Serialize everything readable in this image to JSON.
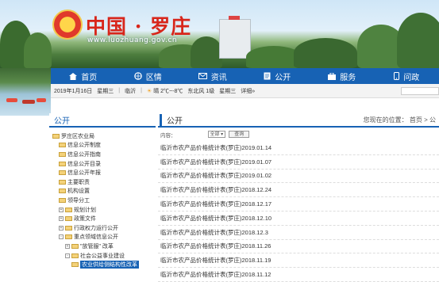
{
  "banner": {
    "brand": "中国 · 罗庄",
    "url": "www.luozhuang.gov.cn"
  },
  "nav": [
    {
      "label": "首页",
      "icon": "home-icon"
    },
    {
      "label": "区情",
      "icon": "globe-icon"
    },
    {
      "label": "资讯",
      "icon": "mail-icon"
    },
    {
      "label": "公开",
      "icon": "document-icon"
    },
    {
      "label": "服务",
      "icon": "service-icon"
    },
    {
      "label": "问政",
      "icon": "phone-icon"
    }
  ],
  "info": {
    "date": "2019年1月16日",
    "weekday": "星期三",
    "city": "临沂",
    "weather": "晴 2℃~-8℃",
    "wind": "东北风 1级",
    "day": "星期三",
    "detail": "详细»"
  },
  "sidebar": {
    "title": "公开",
    "items": [
      {
        "label": "罗庄区农业局",
        "level": 0,
        "toggle": ""
      },
      {
        "label": "信息公开制度",
        "level": 1,
        "toggle": ""
      },
      {
        "label": "信息公开指南",
        "level": 1,
        "toggle": ""
      },
      {
        "label": "信息公开目录",
        "level": 1,
        "toggle": ""
      },
      {
        "label": "信息公开年报",
        "level": 1,
        "toggle": ""
      },
      {
        "label": "主要职责",
        "level": 1,
        "toggle": ""
      },
      {
        "label": "机构设置",
        "level": 1,
        "toggle": ""
      },
      {
        "label": "领导分工",
        "level": 1,
        "toggle": ""
      },
      {
        "label": "规划计划",
        "level": 1,
        "toggle": "+"
      },
      {
        "label": "政策文件",
        "level": 1,
        "toggle": "+"
      },
      {
        "label": "行政权力运行公开",
        "level": 1,
        "toggle": "+"
      },
      {
        "label": "重点领域信息公开",
        "level": 1,
        "toggle": "-"
      },
      {
        "label": "\"放管服\" 改革",
        "level": 2,
        "toggle": "+"
      },
      {
        "label": "社会公益事业建设",
        "level": 2,
        "toggle": "-"
      },
      {
        "label": "农业供给侧结构性改革",
        "level": 3,
        "toggle": "",
        "active": true
      }
    ]
  },
  "main": {
    "title": "公开",
    "breadcrumb": "您现在的位置： 首页 > 公",
    "filter_label": "内容：",
    "filter_value": "全部",
    "search_button": "查询",
    "rows": [
      "临沂市农产品价格统计表(罗庄)2019.01.14",
      "临沂市农产品价格统计表(罗庄)2019.01.07",
      "临沂市农产品价格统计表(罗庄)2019.01.02",
      "临沂市农产品价格统计表(罗庄)2018.12.24",
      "临沂市农产品价格统计表(罗庄)2018.12.17",
      "临沂市农产品价格统计表(罗庄)2018.12.10",
      "临沂市农产品价格统计表(罗庄)2018.12.3",
      "临沂市农产品价格统计表(罗庄)2018.11.26",
      "临沂市农产品价格统计表(罗庄)2018.11.19",
      "临沂市农产品价格统计表(罗庄)2018.11.12"
    ]
  }
}
